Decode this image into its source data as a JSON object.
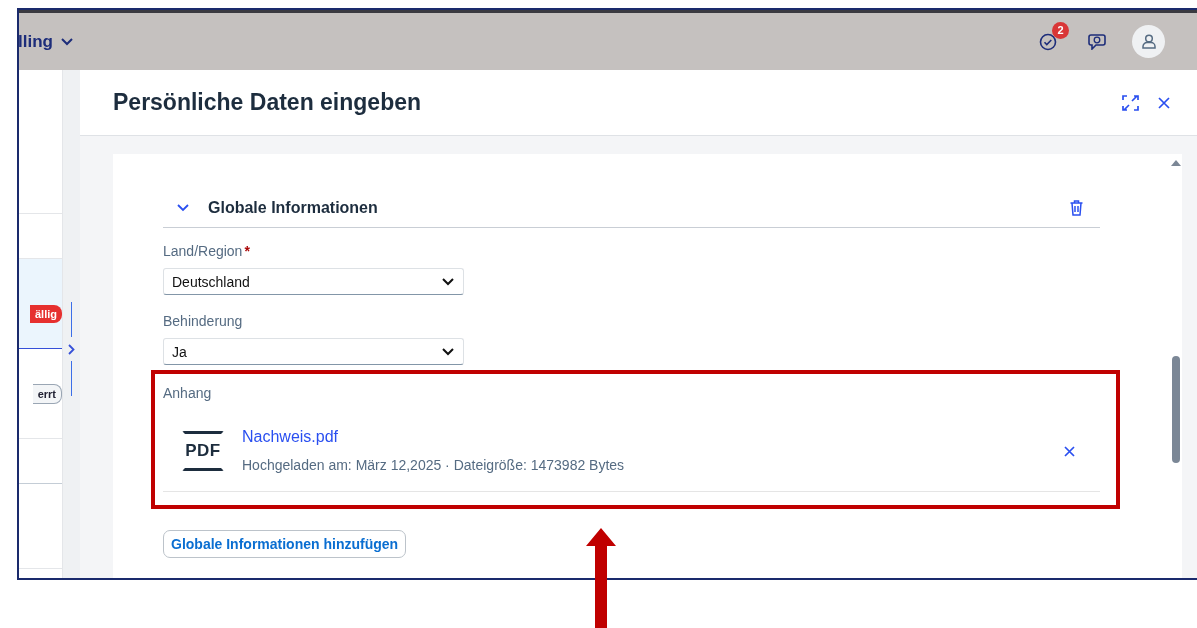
{
  "top_bar": {
    "menu_label": "lling",
    "notification_count": "2"
  },
  "list": {
    "rows": [
      {
        "badge": "ällig",
        "kind": "negative",
        "selected": true
      },
      {
        "badge": "errt",
        "kind": "neutral",
        "selected": false
      }
    ]
  },
  "dialog": {
    "title": "Persönliche Daten eingeben",
    "section": {
      "title": "Globale Informationen",
      "expanded": true,
      "fields": [
        {
          "label": "Land/Region",
          "required_marker": "*",
          "value": "Deutschland"
        },
        {
          "label": "Behinderung",
          "value": "Ja"
        }
      ],
      "attachment": {
        "label": "Anhang",
        "file_type": "PDF",
        "file_name": "Nachweis.pdf",
        "meta": "Hochgeladen am: März 12,2025 · Dateigröße: 1473982 Bytes"
      }
    },
    "add_button": "Globale Informationen hinzufügen"
  }
}
